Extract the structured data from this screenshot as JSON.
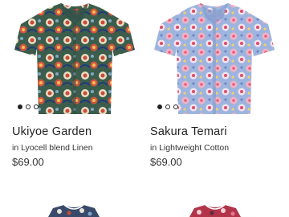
{
  "products": [
    {
      "title": "Ukiyoe Garden",
      "material": "in Lyocell blend Linen",
      "price": "$69.00",
      "image_icon": "shirt-icon",
      "carousel_dots": 3,
      "carousel_active": 0
    },
    {
      "title": "Sakura Temari",
      "material": "in Lightweight Cotton",
      "price": "$69.00",
      "image_icon": "shirt-icon",
      "carousel_dots": 3,
      "carousel_active": 0
    }
  ],
  "colors": {
    "shirt1_base": "#3c5d4c",
    "shirt1_accent": "#c94a37",
    "shirt2_base": "#8fa9d8",
    "shirt2_accent": "#e2627c"
  }
}
